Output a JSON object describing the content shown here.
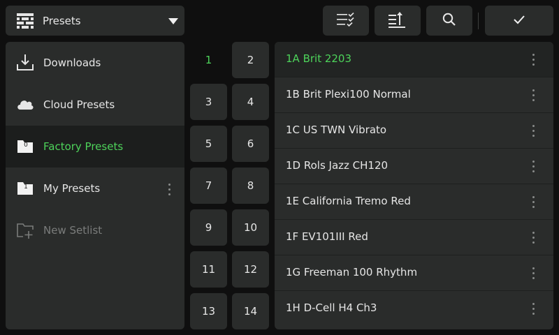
{
  "header": {
    "dropdown_label": "Presets",
    "buttons": [
      {
        "name": "edit-list-icon"
      },
      {
        "name": "sort-icon"
      },
      {
        "name": "search-icon"
      },
      {
        "name": "confirm-check-icon"
      }
    ]
  },
  "sidebar": {
    "items": [
      {
        "label": "Downloads",
        "icon": "download-icon"
      },
      {
        "label": "Cloud Presets",
        "icon": "cloud-icon"
      },
      {
        "label": "Factory Presets",
        "icon": "folder-icon",
        "badge": "0",
        "selected": true
      },
      {
        "label": "My Presets",
        "icon": "folder-icon",
        "badge": "1"
      },
      {
        "label": "New Setlist",
        "icon": "new-folder-icon",
        "disabled": true
      }
    ]
  },
  "banks": [
    "1",
    "2",
    "3",
    "4",
    "5",
    "6",
    "7",
    "8",
    "9",
    "10",
    "11",
    "12",
    "13",
    "14"
  ],
  "selected_bank": "1",
  "presets": [
    {
      "label": "1A Brit 2203",
      "selected": true
    },
    {
      "label": "1B Brit Plexi100 Normal"
    },
    {
      "label": "1C US TWN Vibrato"
    },
    {
      "label": "1D Rols Jazz CH120"
    },
    {
      "label": "1E California Tremo Red"
    },
    {
      "label": "1F EV101III Red"
    },
    {
      "label": "1G Freeman 100 Rhythm"
    },
    {
      "label": "1H D-Cell H4 Ch3"
    }
  ],
  "colors": {
    "accent": "#4dd35a",
    "panel": "#2a2c2b",
    "background": "#0f0f0f",
    "selected_row": "#1c1e1d"
  }
}
